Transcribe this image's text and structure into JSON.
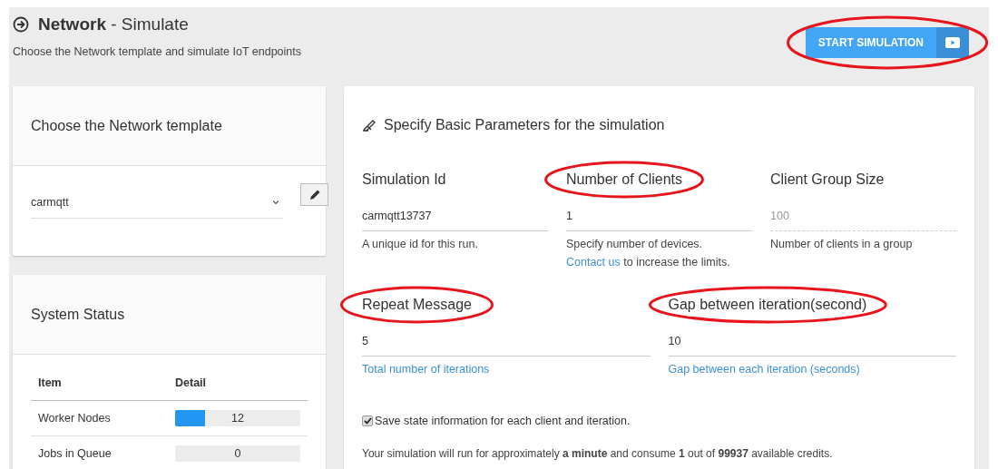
{
  "header": {
    "title": "**Network** - Simulate",
    "subtitle": "Choose the Network template and simulate IoT endpoints"
  },
  "start_button": {
    "label": "START SIMULATION",
    "circled": true
  },
  "template_card": {
    "title": "Choose the Network template",
    "selected_template": "carmqtt"
  },
  "status_card": {
    "title": "System Status",
    "columns": [
      "Item",
      "Detail"
    ],
    "rows": [
      {
        "item": "Worker Nodes",
        "reading": "12",
        "level": 0.24
      },
      {
        "item": "Jobs in Queue",
        "reading": "0",
        "level": 0
      }
    ]
  },
  "parameters": {
    "title": "Specify Basic Parameters for the simulation",
    "field_rows": [
      [
        {
          "label": "Simulation Id",
          "value": "carmqtt13737",
          "disabled": false,
          "circled": false,
          "help": [
            {
              "kind": "text",
              "text": "A unique id for this run."
            }
          ]
        },
        {
          "label": "Number of Clients",
          "value": "1",
          "disabled": false,
          "circled": true,
          "help": [
            {
              "kind": "text",
              "text": "Specify number of devices. "
            },
            {
              "kind": "link",
              "text": "Contact us"
            },
            {
              "kind": "text",
              "text": " to increase the limits."
            }
          ]
        },
        {
          "label": "Client Group Size",
          "value": "100",
          "disabled": true,
          "circled": false,
          "help": [
            {
              "kind": "text",
              "text": "Number of clients in a group"
            }
          ]
        }
      ],
      [
        {
          "label": "Repeat Message",
          "value": "5",
          "disabled": false,
          "circled": true,
          "help": [
            {
              "kind": "link",
              "text": "Total number of iterations"
            }
          ]
        },
        {
          "label": "Gap between iteration(second)",
          "value": "10",
          "disabled": false,
          "circled": true,
          "help": [
            {
              "kind": "link",
              "text": "Gap between each iteration (seconds)"
            }
          ]
        }
      ]
    ],
    "save_state": {
      "label": "Save state information for each client and iteration.",
      "checked": true
    },
    "summary": "Your simulation will run for approximately **a minute** and consume **1** out of **99937** available credits."
  }
}
